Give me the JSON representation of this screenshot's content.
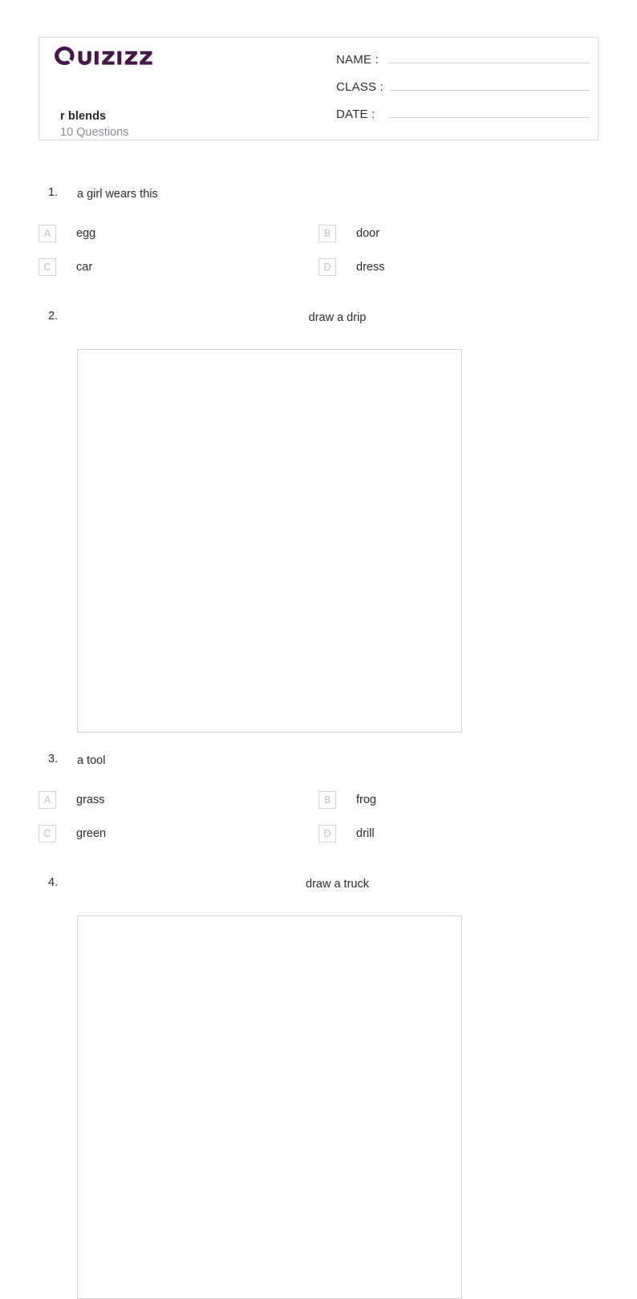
{
  "brand": {
    "logo_text": "Quizizz",
    "logo_color": "#46184a",
    "logo_icon": "quizizz-wordmark-logo"
  },
  "header": {
    "title": "r blends",
    "subtitle": "10 Questions",
    "fields": [
      {
        "label": "NAME :",
        "value": ""
      },
      {
        "label": "CLASS :",
        "value": ""
      },
      {
        "label": "DATE  :",
        "value": ""
      }
    ]
  },
  "questions": [
    {
      "number": "1.",
      "type": "multiple-choice",
      "prompt": "a girl wears this",
      "options": [
        {
          "letter": "A",
          "text": "egg"
        },
        {
          "letter": "B",
          "text": "door"
        },
        {
          "letter": "C",
          "text": "car"
        },
        {
          "letter": "D",
          "text": "dress"
        }
      ]
    },
    {
      "number": "2.",
      "type": "draw",
      "prompt": "draw a drip"
    },
    {
      "number": "3.",
      "type": "multiple-choice",
      "prompt": "a tool",
      "options": [
        {
          "letter": "A",
          "text": "grass"
        },
        {
          "letter": "B",
          "text": "frog"
        },
        {
          "letter": "C",
          "text": "green"
        },
        {
          "letter": "D",
          "text": "drill"
        }
      ]
    },
    {
      "number": "4.",
      "type": "draw",
      "prompt": "draw a truck"
    }
  ]
}
